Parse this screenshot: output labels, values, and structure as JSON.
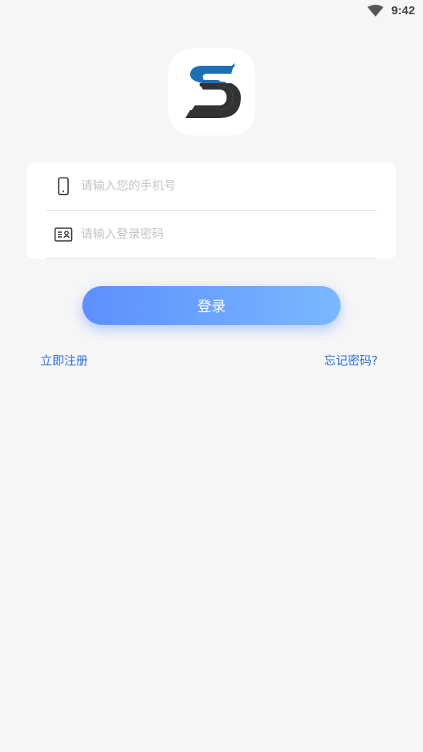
{
  "status_bar": {
    "time": "9:42",
    "wifi_icon": "wifi-icon"
  },
  "logo": {
    "icon": "app-logo-s",
    "colors": {
      "primary": "#1f6fb5",
      "secondary": "#333333"
    }
  },
  "form": {
    "phone": {
      "placeholder": "请输入您的手机号",
      "value": "",
      "icon": "phone-icon"
    },
    "password": {
      "placeholder": "请输入登录密码",
      "value": "",
      "icon": "id-card-icon"
    }
  },
  "login_button": {
    "label": "登录"
  },
  "links": {
    "register": "立即注册",
    "forgot_password": "忘记密码?"
  },
  "colors": {
    "accent": "#5d8ffc",
    "link": "#2e6fd6",
    "background": "#f6f6f6"
  }
}
